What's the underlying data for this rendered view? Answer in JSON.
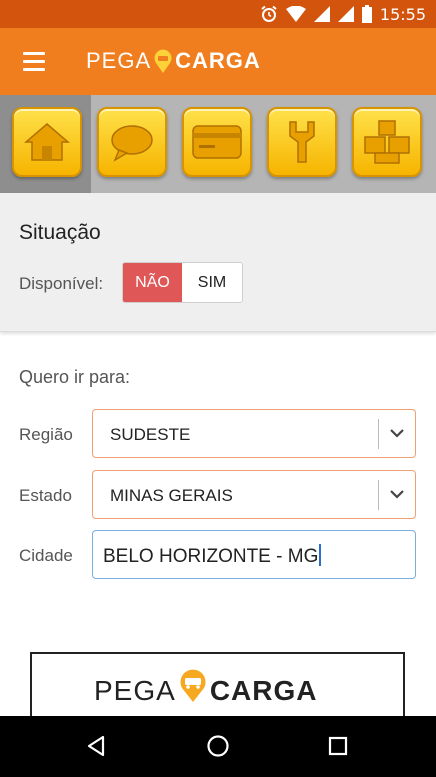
{
  "status_bar": {
    "time": "15:55",
    "icons": [
      "alarm-icon",
      "wifi-icon",
      "signal-icon",
      "signal-icon",
      "battery-icon"
    ]
  },
  "app_bar": {
    "menu_icon": "hamburger-menu-icon",
    "logo_left": "PEGA",
    "logo_right": "CARGA"
  },
  "toolbar": {
    "items": [
      "home-icon",
      "chat-icon",
      "card-icon",
      "tools-icon",
      "boxes-icon"
    ]
  },
  "situacao": {
    "title": "Situação",
    "disponivel_label": "Disponível:",
    "option_no": "NÃO",
    "option_yes": "SIM",
    "selected": "NÃO"
  },
  "form": {
    "heading": "Quero ir para:",
    "regiao_label": "Região",
    "regiao_value": "SUDESTE",
    "estado_label": "Estado",
    "estado_value": "MINAS GERAIS",
    "cidade_label": "Cidade",
    "cidade_value": "BELO HORIZONTE - MG"
  },
  "footer": {
    "logo_left": "PEGA",
    "logo_right": "CARGA"
  },
  "nav": {
    "buttons": [
      "back-icon",
      "home-circle-icon",
      "recents-icon"
    ]
  },
  "colors": {
    "status_bar": "#d3540d",
    "app_bar": "#f07d1e",
    "toggle_active": "#e05757",
    "icon_gold": "#f6b400"
  }
}
